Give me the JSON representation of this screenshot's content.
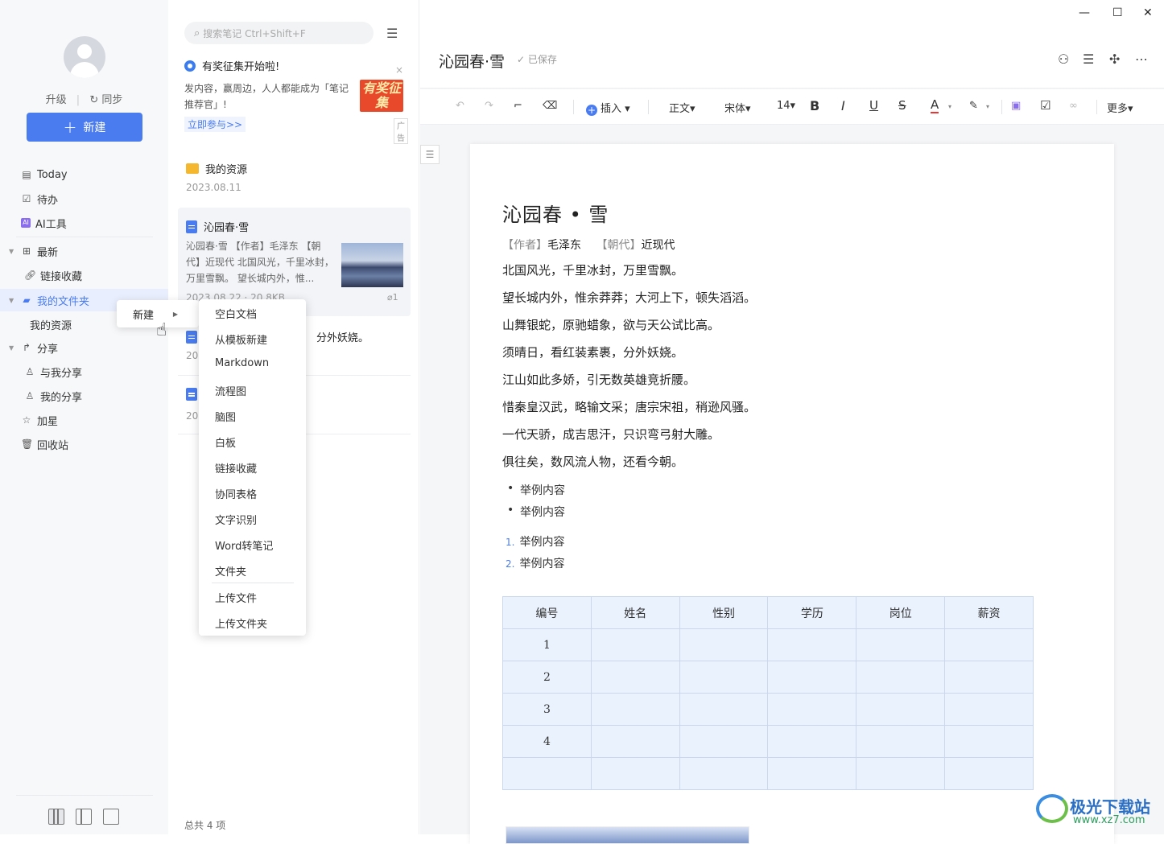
{
  "sidebar": {
    "upgrade": "升级",
    "sync": "同步",
    "new_button": "新建",
    "nav": [
      {
        "label": "Today",
        "icon": "calendar-icon"
      },
      {
        "label": "待办",
        "icon": "checkbox-icon"
      },
      {
        "label": "AI工具",
        "icon": "ai-icon"
      },
      {
        "label": "最新",
        "icon": "grid-icon"
      },
      {
        "label": "链接收藏",
        "icon": "link-icon"
      },
      {
        "label": "我的文件夹",
        "icon": "folder-icon"
      },
      {
        "label": "我的资源",
        "icon": ""
      },
      {
        "label": "分享",
        "icon": "share-icon"
      },
      {
        "label": "与我分享",
        "icon": "user-icon"
      },
      {
        "label": "我的分享",
        "icon": "user-icon"
      },
      {
        "label": "加星",
        "icon": "star-icon"
      },
      {
        "label": "回收站",
        "icon": "trash-icon"
      }
    ]
  },
  "notelist": {
    "search_placeholder": "搜索笔记 Ctrl+Shift+F",
    "ad": {
      "title": "有奖征集开始啦!",
      "body": "发内容，赢周边，人人都能成为「笔记推荐官」!",
      "image_text": "有奖征集",
      "cta": "立即参与>>",
      "tag": "广告",
      "close": "×"
    },
    "notes": [
      {
        "title": "我的资源",
        "date": "2023.08.11"
      },
      {
        "title": "沁园春·雪",
        "snippet": "沁园春·雪 【作者】毛泽东 【朝代】近现代 北国风光，千里冰封，万里雪飘。 望长城内外，惟...",
        "date": "2023.08.22 · 20.8KB",
        "attach": "1"
      },
      {
        "title": "分外妖娆。",
        "date": "202"
      },
      {
        "title": "",
        "date": "202"
      }
    ],
    "count": "总共 4 项"
  },
  "context_menu": {
    "parent": "新建",
    "items": [
      "空白文档",
      "从模板新建",
      "Markdown",
      "流程图",
      "脑图",
      "白板",
      "链接收藏",
      "协同表格",
      "文字识别",
      "Word转笔记",
      "文件夹",
      "上传文件",
      "上传文件夹"
    ]
  },
  "editor": {
    "title": "沁园春·雪",
    "saved": "已保存",
    "toolbar": {
      "insert": "插入",
      "style": "正文",
      "font": "宋体",
      "size": "14",
      "more": "更多"
    },
    "doc": {
      "title": "沁园春 • 雪",
      "author_label": "【作者】",
      "author": "毛泽东",
      "dynasty_label": "【朝代】",
      "dynasty": "近现代",
      "lines": [
        "北国风光，千里冰封，万里雪飘。",
        "望长城内外，惟余莽莽；大河上下，顿失滔滔。",
        "山舞银蛇，原驰蜡象，欲与天公试比高。",
        "须晴日，看红装素裹，分外妖娆。",
        "江山如此多娇，引无数英雄竞折腰。",
        "惜秦皇汉武，略输文采；唐宗宋祖，稍逊风骚。",
        "一代天骄，成吉思汗，只识弯弓射大雕。",
        "俱往矣，数风流人物，还看今朝。"
      ],
      "bullets": [
        "举例内容",
        "举例内容"
      ],
      "ordered": [
        {
          "n": "1.",
          "text": "举例内容"
        },
        {
          "n": "2.",
          "text": "举例内容"
        }
      ],
      "table": {
        "headers": [
          "编号",
          "姓名",
          "性别",
          "学历",
          "岗位",
          "薪资"
        ],
        "rows": [
          [
            "1",
            "",
            "",
            "",
            "",
            ""
          ],
          [
            "2",
            "",
            "",
            "",
            "",
            ""
          ],
          [
            "3",
            "",
            "",
            "",
            "",
            ""
          ],
          [
            "4",
            "",
            "",
            "",
            "",
            ""
          ],
          [
            "",
            "",
            "",
            "",
            "",
            ""
          ]
        ]
      }
    }
  },
  "watermark": {
    "title": "极光下载站",
    "url": "www.xz7.com"
  }
}
